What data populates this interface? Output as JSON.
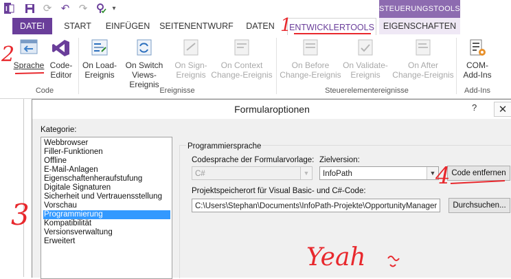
{
  "titlebar": {
    "context_header": "STEUERUNGSTOOLS"
  },
  "tabs": [
    {
      "label": "DATEI"
    },
    {
      "label": "START"
    },
    {
      "label": "EINFÜGEN"
    },
    {
      "label": "SEITENENTWURF"
    },
    {
      "label": "DATEN"
    },
    {
      "label": "ENTWICKLERTOOLS"
    },
    {
      "label": "EIGENSCHAFTEN"
    }
  ],
  "ribbon": {
    "code_group": {
      "label": "Code",
      "buttons": [
        {
          "line1": "Sprache",
          "line2": ""
        },
        {
          "line1": "Code-",
          "line2": "Editor"
        }
      ]
    },
    "events_group": {
      "label": "Ereignisse",
      "buttons": [
        {
          "line1": "On Load-",
          "line2": "Ereignis"
        },
        {
          "line1": "On Switch",
          "line2": "Views-Ereignis"
        },
        {
          "line1": "On Sign-",
          "line2": "Ereignis"
        },
        {
          "line1": "On Context",
          "line2": "Change-Ereignis"
        }
      ]
    },
    "control_events_group": {
      "label": "Steuerelementereignisse",
      "buttons": [
        {
          "line1": "On Before",
          "line2": "Change-Ereignis"
        },
        {
          "line1": "On Validate-",
          "line2": "Ereignis"
        },
        {
          "line1": "On After",
          "line2": "Change-Ereignis"
        }
      ]
    },
    "addins_group": {
      "label": "Add-Ins",
      "buttons": [
        {
          "line1": "COM-",
          "line2": "Add-Ins"
        }
      ]
    }
  },
  "dialog": {
    "title": "Formularoptionen",
    "help": "?",
    "close": "✕",
    "category_label": "Kategorie:",
    "categories": [
      "Webbrowser",
      "Filler-Funktionen",
      "Offline",
      "E-Mail-Anlagen",
      "Eigenschaftenheraufstufung",
      "Digitale Signaturen",
      "Sicherheit und Vertrauensstellung",
      "Vorschau",
      "Programmierung",
      "Kompatibilität",
      "Versionsverwaltung",
      "Erweitert"
    ],
    "selected_category": "Programmierung",
    "section_title": "Programmiersprache",
    "template_lang_label": "Codesprache der Formularvorlage:",
    "template_lang_value": "C#",
    "target_version_label": "Zielversion:",
    "target_version_value": "InfoPath",
    "remove_code_button": "Code entfernen",
    "project_location_label": "Projektspeicherort für Visual Basic- und C#-Code:",
    "project_location_value": "C:\\Users\\Stephan\\Documents\\InfoPath-Projekte\\OpportunityManager",
    "browse_button": "Durchsuchen..."
  },
  "annotations": {
    "n1": "1",
    "n2": "2",
    "n3": "3",
    "n4": "4",
    "yeah": "Yeah"
  },
  "colors": {
    "accent": "#6a3e9a",
    "context": "#8d6bb0",
    "selection": "#3399ff",
    "annotation": "#e8282d"
  }
}
